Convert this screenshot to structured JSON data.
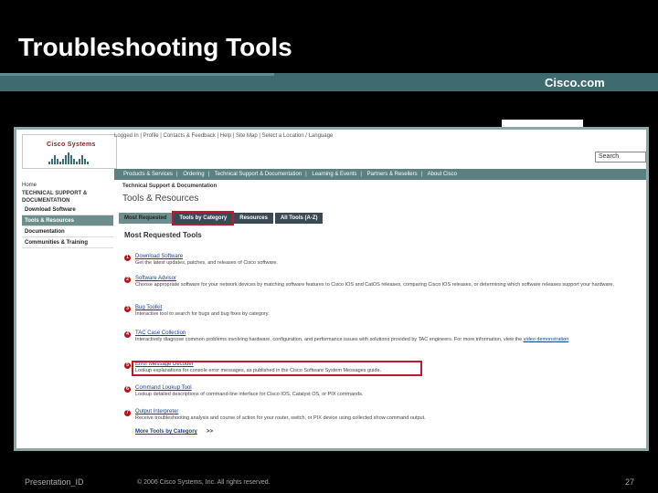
{
  "slide": {
    "title": "Troubleshooting Tools",
    "brand": "Cisco.com",
    "footer_left": "Presentation_ID",
    "footer_center": "© 2006 Cisco Systems, Inc. All rights reserved.",
    "page_number": "27"
  },
  "site": {
    "logo_text": "Cisco Systems",
    "top_links": "Logged In | Profile | Contacts & Feedback | Help | Site Map | Select a Location / Language",
    "search_placeholder": "Search",
    "nav": [
      "Products & Services",
      "Ordering",
      "Technical Support & Documentation",
      "Learning & Events",
      "Partners & Resellers",
      "About Cisco"
    ],
    "sidebar": {
      "home": "Home",
      "section": "TECHNICAL SUPPORT & DOCUMENTATION",
      "items": [
        {
          "label": "Download Software",
          "active": false
        },
        {
          "label": "Tools & Resources",
          "active": true
        },
        {
          "label": "Documentation",
          "active": false
        },
        {
          "label": "Communities & Training",
          "active": false
        }
      ]
    },
    "breadcrumb": "Technical Support & Documentation",
    "page_title": "Tools & Resources",
    "tabs": [
      {
        "label": "Most Requested",
        "active": true,
        "highlighted": false
      },
      {
        "label": "Tools by Category",
        "active": false,
        "highlighted": true
      },
      {
        "label": "Resources",
        "active": false,
        "highlighted": false
      },
      {
        "label": "All Tools (A-Z)",
        "active": false,
        "highlighted": false
      }
    ],
    "section_title": "Most Requested Tools",
    "tools": [
      {
        "num": "1",
        "name": "Download Software",
        "desc": "Get the latest updates, patches, and releases of Cisco software."
      },
      {
        "num": "2",
        "name": "Software Advisor",
        "desc": "Choose appropriate software for your network devices by matching software features to Cisco IOS and CatOS releases, comparing Cisco IOS releases, or determining which software releases support your hardware."
      },
      {
        "num": "3",
        "name": "Bug Toolkit",
        "desc": "Interactive tool to search for bugs and bug fixes by category."
      },
      {
        "num": "4",
        "name": "TAC Case Collection",
        "desc": "Interactively diagnose common problems involving hardware, configuration, and performance issues with solutions provided by TAC engineers. For more information, view the",
        "link": "video demonstration"
      },
      {
        "num": "5",
        "name": "Error Message Decoder",
        "desc": "Lookup explanations for console error messages, as published in the Cisco Software System Messages guide."
      },
      {
        "num": "6",
        "name": "Command Lookup Tool",
        "desc": "Lookup detailed descriptions of command-line interface for Cisco IOS, Catalyst OS, or PIX commands."
      },
      {
        "num": "7",
        "name": "Output Interpreter",
        "desc": "Receive troubleshooting analysis and course of action for your router, switch, or PIX device using collected show command output."
      }
    ],
    "more_tools": "More Tools by Category",
    "more_arrow": ">>"
  },
  "colors": {
    "accent_red": "#c0182f",
    "teal_band": "#3d6b70",
    "link_blue": "#1d3e8c"
  }
}
